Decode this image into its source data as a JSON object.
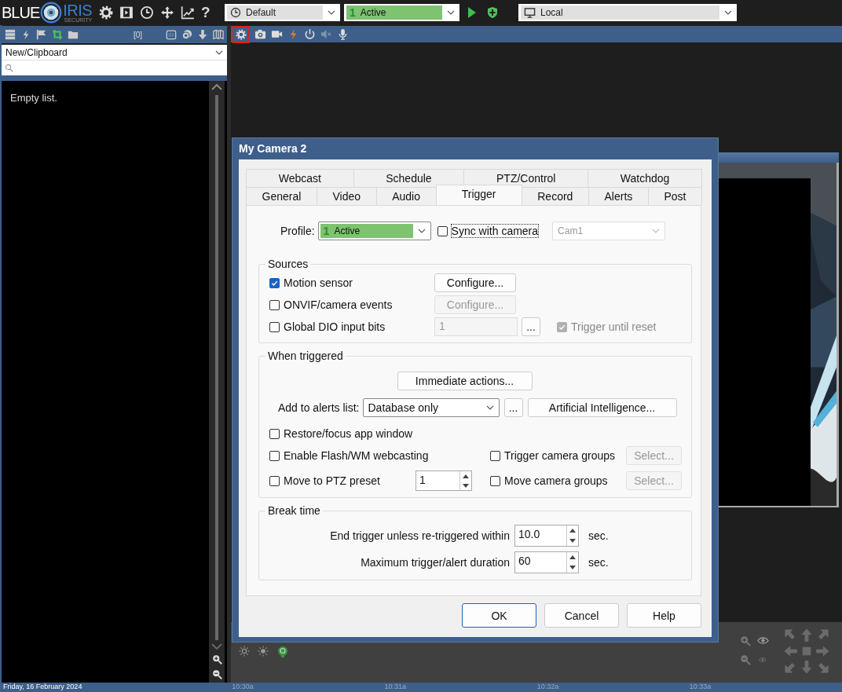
{
  "app": {
    "logo": {
      "left": "BLUE",
      "right": "IRIS",
      "tagline": "SECURITY"
    },
    "help_glyph": "?"
  },
  "top_bar": {
    "schedule": "Default",
    "profile": {
      "number": "1",
      "label": "Active"
    },
    "server": "Local"
  },
  "clips_panel": {
    "count": "[0]",
    "folder": "New/Clipboard",
    "empty_message": "Empty list."
  },
  "camera_toolbar": {
    "settings_highlighted": true
  },
  "dialog": {
    "title": "My Camera 2",
    "tab_rows": [
      [
        {
          "label": "Webcast",
          "selected": false
        },
        {
          "label": "Schedule",
          "selected": false
        },
        {
          "label": "PTZ/Control",
          "selected": false
        },
        {
          "label": "Watchdog",
          "selected": false
        }
      ],
      [
        {
          "label": "General",
          "selected": false
        },
        {
          "label": "Video",
          "selected": false
        },
        {
          "label": "Audio",
          "selected": false
        },
        {
          "label": "Trigger",
          "selected": true
        },
        {
          "label": "Record",
          "selected": false
        },
        {
          "label": "Alerts",
          "selected": false
        },
        {
          "label": "Post",
          "selected": false
        }
      ]
    ],
    "profile": {
      "label": "Profile:",
      "number": "1",
      "value": "Active",
      "sync": {
        "label": "Sync with camera",
        "checked": false,
        "focused": true
      },
      "camera": {
        "value": "Cam1",
        "disabled": true
      }
    },
    "sources": {
      "title": "Sources",
      "rows": [
        {
          "kind": "button",
          "label": "Motion sensor",
          "checked": true,
          "button": {
            "label": "Configure...",
            "disabled": false
          }
        },
        {
          "kind": "button",
          "label": "ONVIF/camera events",
          "checked": false,
          "button": {
            "label": "Configure...",
            "disabled": true
          }
        },
        {
          "kind": "bits",
          "label": "Global DIO input bits",
          "checked": false,
          "field": {
            "value": "1",
            "disabled": true
          },
          "browse": "...",
          "extra": {
            "label": "Trigger until reset",
            "checked": true,
            "disabled": true
          }
        }
      ]
    },
    "when_triggered": {
      "title": "When triggered",
      "actions_button": "Immediate actions...",
      "alerts_label": "Add to alerts list:",
      "alerts_value": "Database only",
      "browse": "...",
      "ai_button": "Artificial Intelligence...",
      "restore": {
        "label": "Restore/focus app window",
        "checked": false
      },
      "rows": [
        {
          "left": {
            "label": "Enable Flash/WM webcasting",
            "checked": false
          },
          "right": {
            "label": "Trigger camera groups",
            "checked": false,
            "button": {
              "label": "Select...",
              "disabled": true
            }
          }
        },
        {
          "left": {
            "label": "Move to PTZ preset",
            "checked": false,
            "spinner": "1"
          },
          "right": {
            "label": "Move camera groups",
            "checked": false,
            "button": {
              "label": "Select...",
              "disabled": true
            }
          }
        }
      ]
    },
    "break_time": {
      "title": "Break time",
      "rows": [
        {
          "label": "End trigger unless re-triggered within",
          "value": "10.0",
          "unit": "sec."
        },
        {
          "label": "Maximum trigger/alert duration",
          "value": "60",
          "unit": "sec."
        }
      ]
    },
    "buttons": [
      {
        "label": "OK",
        "default": true
      },
      {
        "label": "Cancel",
        "default": false
      },
      {
        "label": "Help",
        "default": false
      }
    ]
  },
  "timeline": {
    "date": "Friday, 16 February 2024",
    "ticks": [
      "10:30a",
      "10:31a",
      "10:32a",
      "10:33a"
    ]
  }
}
